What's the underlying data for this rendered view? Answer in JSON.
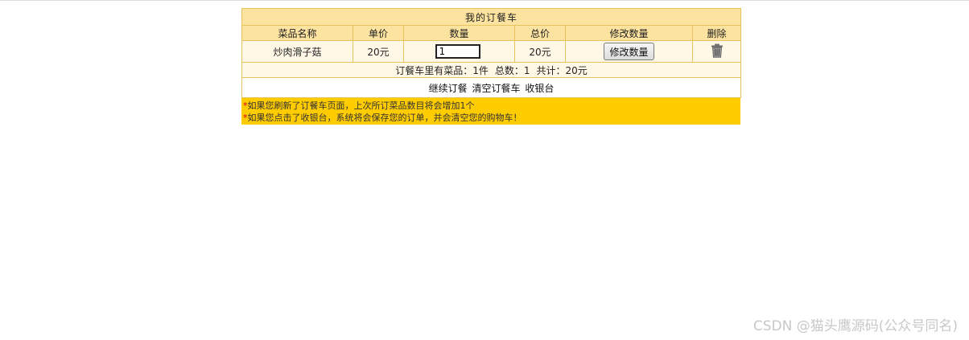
{
  "cart": {
    "title": "我的订餐车",
    "headers": {
      "name": "菜品名称",
      "unit_price": "单价",
      "quantity": "数量",
      "total": "总价",
      "modify": "修改数量",
      "delete": "删除"
    },
    "items": [
      {
        "name": "炒肉滑子菇",
        "unit_price": "20元",
        "quantity": "1",
        "total": "20元",
        "modify_button": "修改数量",
        "delete_icon": "trash-icon"
      }
    ],
    "summary": {
      "count_label": "订餐车里有菜品：1件",
      "total_qty_label": "总数：1",
      "sum_label": "共计：20元"
    },
    "links": {
      "continue": "继续订餐",
      "clear": "清空订餐车",
      "checkout": "收银台"
    },
    "notes": [
      {
        "star": "*",
        "text": "如果您刷新了订餐车页面，上次所订菜品数目将会增加1个"
      },
      {
        "star": "*",
        "text": "如果您点击了收银台，系统将会保存您的订单，并会清空您的购物车！"
      }
    ]
  },
  "watermark": "CSDN @猫头鹰源码(公众号同名)",
  "colors": {
    "header_bg": "#fde3a0",
    "row_bg": "#fff8e6",
    "border": "#e6c35c",
    "notes_bg": "#ffcc00",
    "star": "#d40000"
  }
}
